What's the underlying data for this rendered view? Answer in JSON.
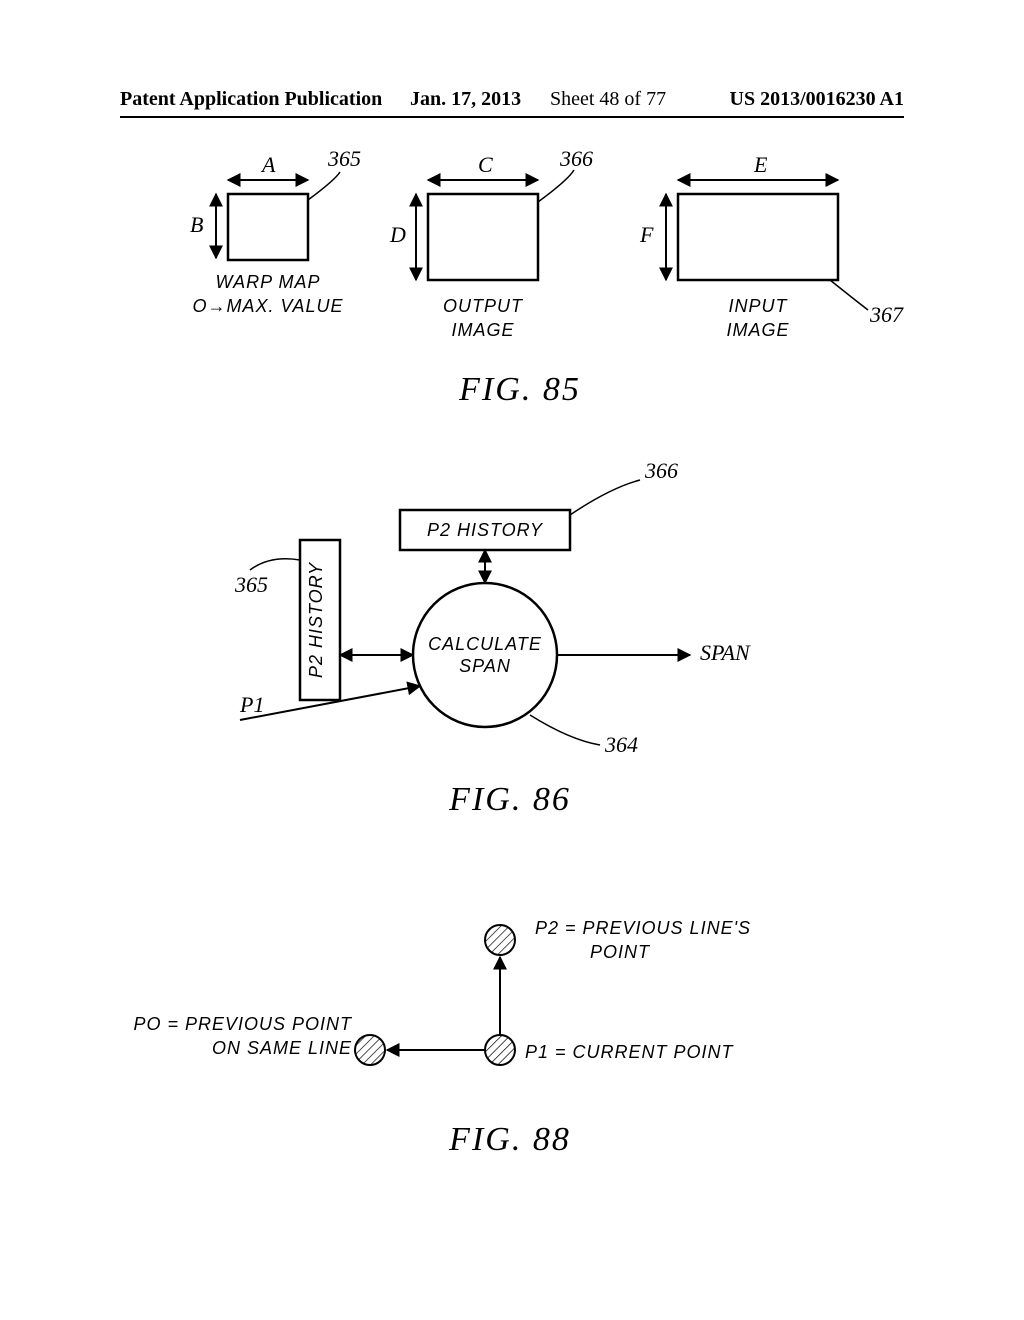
{
  "header": {
    "left": "Patent Application Publication",
    "date": "Jan. 17, 2013",
    "sheet": "Sheet 48 of 77",
    "pubno": "US 2013/0016230 A1"
  },
  "fig85": {
    "label": "FIG. 85",
    "warp": {
      "a": "A",
      "b": "B",
      "caption1": "WARP MAP",
      "caption2": "O→MAX. VALUE",
      "ref": "365"
    },
    "output": {
      "c": "C",
      "d": "D",
      "caption": "OUTPUT\nIMAGE",
      "ref": "366"
    },
    "input": {
      "e": "E",
      "f": "F",
      "caption": "INPUT\nIMAGE",
      "ref": "367"
    }
  },
  "fig86": {
    "label": "FIG. 86",
    "top_box": "P2 HISTORY",
    "side_box": "P2 HISTORY",
    "circle": "CALCULATE\nSPAN",
    "p1": "P1",
    "span": "SPAN",
    "ref_top": "366",
    "ref_side": "365",
    "ref_circle": "364"
  },
  "fig88": {
    "label": "FIG. 88",
    "p2": "P2 = PREVIOUS LINE'S\nPOINT",
    "p0": "PO = PREVIOUS POINT\nON SAME LINE",
    "p1": "P1 = CURRENT POINT"
  }
}
